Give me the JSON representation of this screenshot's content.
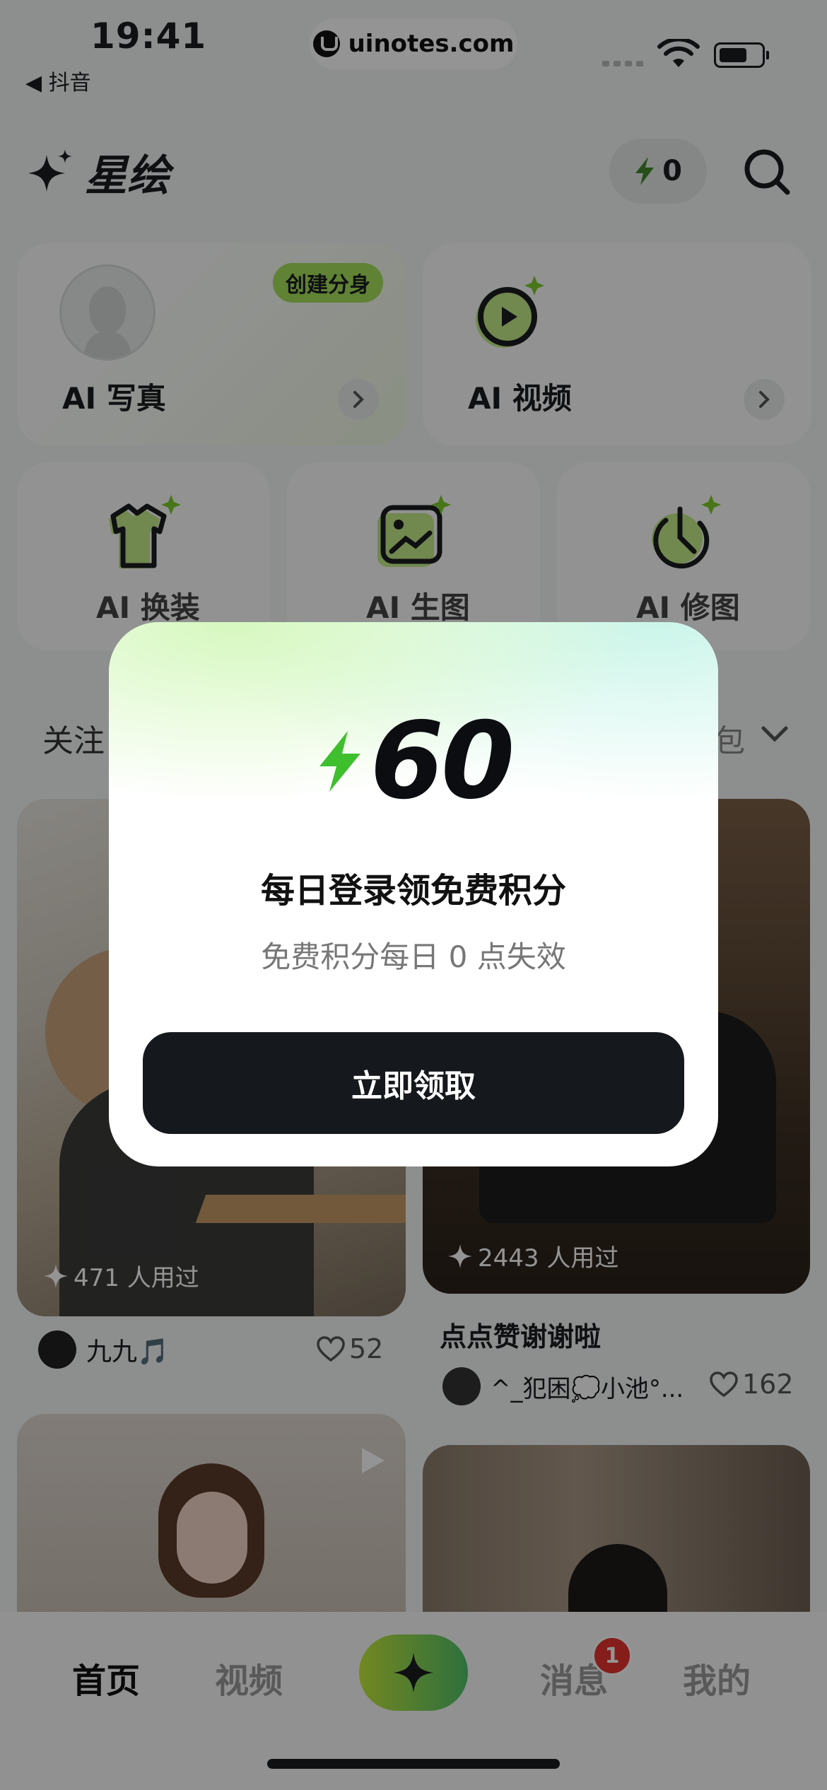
{
  "status_bar": {
    "time": "19:41",
    "back_label": "◀ 抖音",
    "watermark": "uinotes.com"
  },
  "header": {
    "brand": "星绘",
    "points": "0"
  },
  "features": {
    "ai_photo": {
      "label": "AI 写真",
      "badge": "创建分身"
    },
    "ai_video": {
      "label": "AI 视频"
    },
    "ai_outfit": {
      "label": "AI 换装"
    },
    "ai_generate": {
      "label": "AI 生图"
    },
    "ai_retouch": {
      "label": "AI 修图"
    }
  },
  "tabs": {
    "first": "关注",
    "right_partial": "包"
  },
  "feed": [
    {
      "used": "471 人用过",
      "user": "九九🎵",
      "likes": "52"
    },
    {
      "used": "2443 人用过",
      "title": "点点赞谢谢啦",
      "user": "^_犯困💭小池°...",
      "likes": "162"
    }
  ],
  "bottom_nav": {
    "home": "首页",
    "video": "视频",
    "messages": "消息",
    "messages_badge": "1",
    "mine": "我的"
  },
  "modal": {
    "points": "60",
    "title": "每日登录领免费积分",
    "subtitle": "免费积分每日 0 点失效",
    "button": "立即领取"
  },
  "colors": {
    "accent_green": "#7ccc2a",
    "lime": "#a6e05b",
    "dark": "#15181c",
    "badge_red": "#e5342f"
  }
}
